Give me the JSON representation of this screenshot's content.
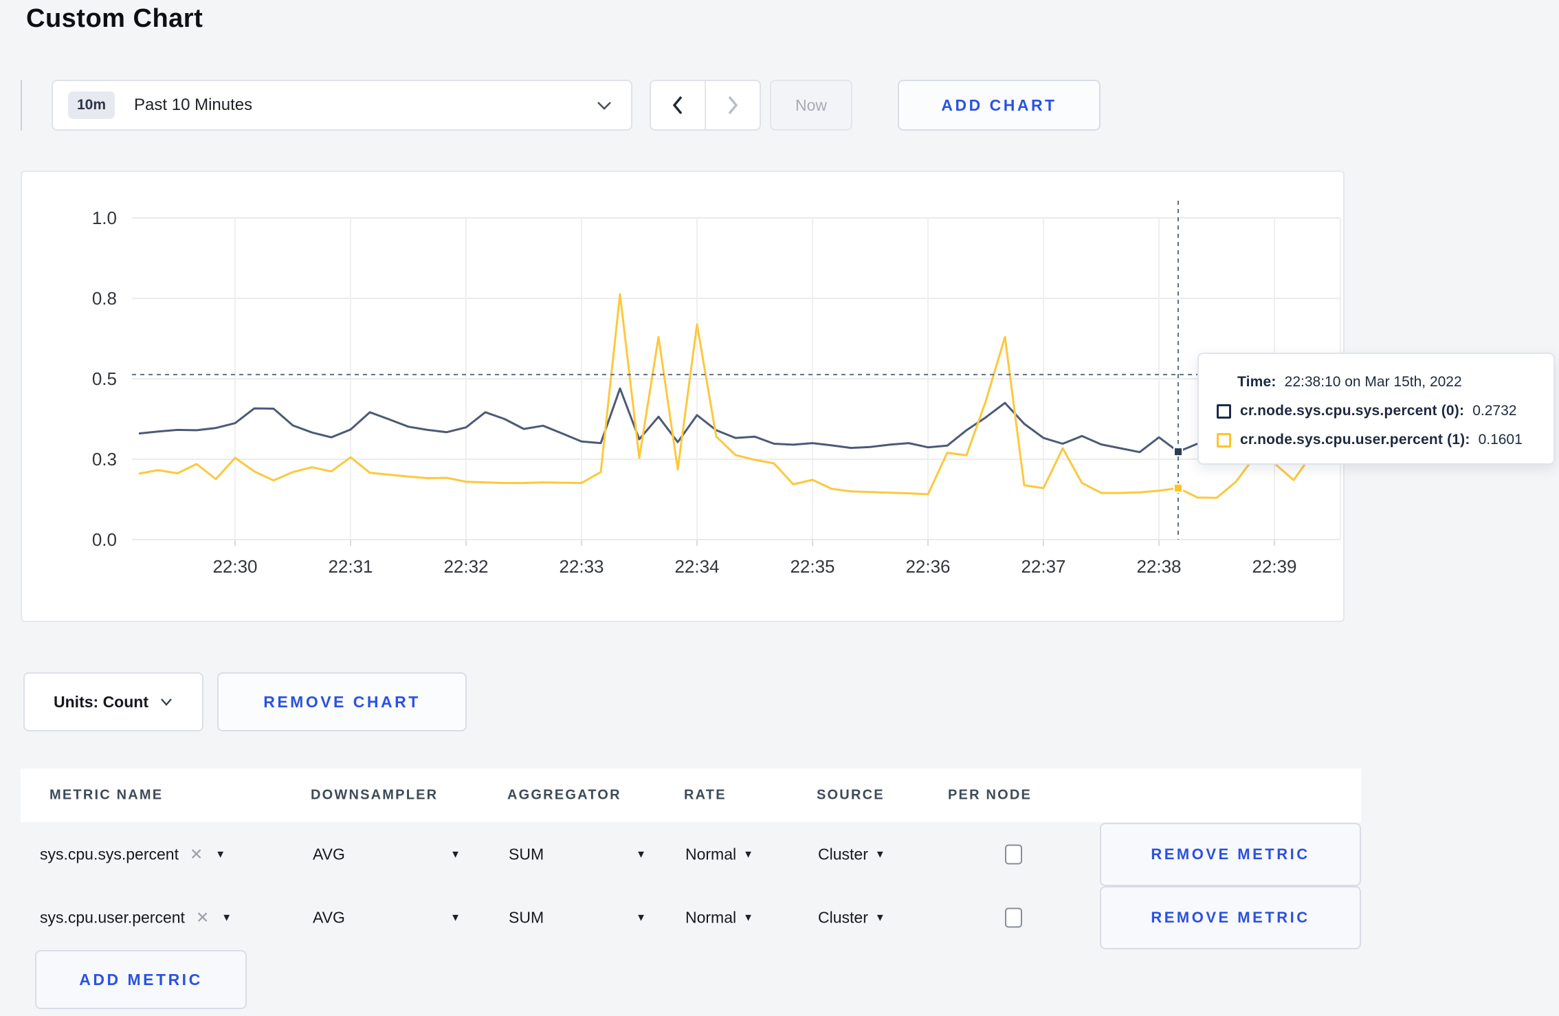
{
  "page": {
    "title": "Custom Chart"
  },
  "toolbar": {
    "time_window_badge": "10m",
    "time_window_label": "Past 10 Minutes",
    "now_label": "Now",
    "add_chart_label": "ADD CHART"
  },
  "chart_data": {
    "type": "line",
    "title": "",
    "xlabel": "",
    "ylabel": "",
    "grid": true,
    "legend_position": "none",
    "y_axis": {
      "range": [
        0,
        1
      ],
      "tick_values": [
        0,
        0.25,
        0.5,
        0.75,
        1
      ],
      "tick_labels": [
        "0.0",
        "0.3",
        "0.5",
        "0.8",
        "1.0"
      ]
    },
    "x_axis": {
      "tick_seconds": [
        60,
        120,
        180,
        240,
        300,
        360,
        420,
        480,
        540,
        600
      ],
      "tick_labels": [
        "22:30",
        "22:31",
        "22:32",
        "22:33",
        "22:34",
        "22:35",
        "22:36",
        "22:37",
        "22:38",
        "22:39"
      ]
    },
    "sample_start_sec": 10,
    "sample_step_sec": 10,
    "series": [
      {
        "name": "cr.node.sys.cpu.sys.percent",
        "color": "#4c5a77",
        "values": [
          0.33,
          0.336,
          0.341,
          0.34,
          0.347,
          0.362,
          0.408,
          0.407,
          0.355,
          0.333,
          0.318,
          0.342,
          0.396,
          0.374,
          0.351,
          0.341,
          0.334,
          0.349,
          0.396,
          0.375,
          0.344,
          0.354,
          0.33,
          0.305,
          0.3,
          0.47,
          0.312,
          0.382,
          0.303,
          0.387,
          0.34,
          0.316,
          0.32,
          0.298,
          0.295,
          0.3,
          0.293,
          0.285,
          0.288,
          0.295,
          0.3,
          0.287,
          0.292,
          0.34,
          0.38,
          0.425,
          0.36,
          0.316,
          0.298,
          0.322,
          0.296,
          0.284,
          0.272,
          0.318,
          0.2732,
          0.298,
          0.31,
          0.305,
          0.3,
          0.299,
          0.305,
          0.308
        ]
      },
      {
        "name": "cr.node.sys.cpu.user.percent",
        "color": "#fcc83c",
        "values": [
          0.205,
          0.216,
          0.206,
          0.235,
          0.188,
          0.254,
          0.212,
          0.184,
          0.21,
          0.225,
          0.212,
          0.256,
          0.208,
          0.202,
          0.196,
          0.191,
          0.192,
          0.18,
          0.178,
          0.176,
          0.176,
          0.178,
          0.177,
          0.176,
          0.21,
          0.763,
          0.254,
          0.63,
          0.218,
          0.669,
          0.32,
          0.263,
          0.248,
          0.237,
          0.172,
          0.186,
          0.158,
          0.15,
          0.148,
          0.146,
          0.144,
          0.141,
          0.27,
          0.262,
          0.43,
          0.63,
          0.169,
          0.16,
          0.284,
          0.176,
          0.145,
          0.145,
          0.147,
          0.152,
          0.1601,
          0.131,
          0.13,
          0.18,
          0.26,
          0.237,
          0.185,
          0.27
        ]
      }
    ],
    "hover": {
      "time_sec": 550,
      "crosshair_value": 0.513,
      "time_label": "Time:",
      "time_value": "22:38:10 on Mar 15th, 2022",
      "rows": [
        {
          "swatch_color": "#1c2c4c",
          "label": "cr.node.sys.cpu.sys.percent (0):",
          "value": "0.2732"
        },
        {
          "swatch_color": "#ffc425",
          "label": "cr.node.sys.cpu.user.percent (1):",
          "value": "0.1601"
        }
      ]
    }
  },
  "units_bar": {
    "units_label": "Units: Count",
    "remove_chart_label": "REMOVE CHART"
  },
  "metrics_table": {
    "headers": [
      "METRIC NAME",
      "DOWNSAMPLER",
      "AGGREGATOR",
      "RATE",
      "SOURCE",
      "PER NODE"
    ],
    "rows": [
      {
        "metric": "sys.cpu.sys.percent",
        "downsampler": "AVG",
        "aggregator": "SUM",
        "rate": "Normal",
        "source": "Cluster",
        "per_node_checked": false,
        "remove_label": "REMOVE METRIC"
      },
      {
        "metric": "sys.cpu.user.percent",
        "downsampler": "AVG",
        "aggregator": "SUM",
        "rate": "Normal",
        "source": "Cluster",
        "per_node_checked": false,
        "remove_label": "REMOVE METRIC"
      }
    ],
    "add_metric_label": "ADD METRIC"
  }
}
